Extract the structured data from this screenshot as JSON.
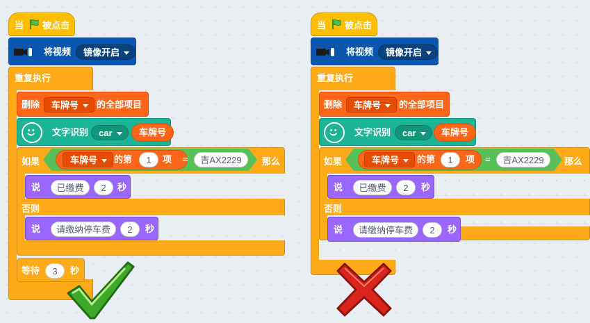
{
  "event": {
    "prefix": "当",
    "suffix": "被点击"
  },
  "video": {
    "label": "将视频",
    "option": "镜像开启"
  },
  "loop": {
    "label": "重复执行"
  },
  "list_delete": {
    "label": "删除",
    "list": "车牌号",
    "suffix": "的全部项目"
  },
  "ocr": {
    "label": "文字识别",
    "lang": "car",
    "var": "车牌号"
  },
  "if": {
    "label": "如果",
    "item_list": "车牌号",
    "item_of": "的第",
    "item_index": "1",
    "item_suffix": "项",
    "equals": "=",
    "value": "吉AX2229",
    "then": "那么"
  },
  "say_paid": {
    "label": "说",
    "text": "已缴费",
    "secs": "2",
    "unit": "秒"
  },
  "else": {
    "label": "否则"
  },
  "say_unpaid": {
    "label": "说",
    "text": "请缴纳停车费",
    "secs": "2",
    "unit": "秒"
  },
  "wait": {
    "label": "等待",
    "secs": "3",
    "unit": "秒"
  },
  "colors": {
    "events": "#ffbf00",
    "control": "#ffab19",
    "video": "#0b57b0",
    "list": "#ff661a",
    "ai": "#1bb496",
    "looks": "#9966ff",
    "operator": "#59c059",
    "check": "#3fa82a",
    "cross": "#d9251d"
  },
  "icons": {
    "flag": "green-flag-icon",
    "camera": "video-camera-icon",
    "ai": "smiley-ai-icon",
    "correct": "check-mark-icon",
    "wrong": "cross-mark-icon"
  }
}
